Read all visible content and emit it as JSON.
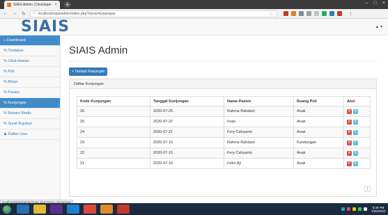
{
  "browser": {
    "tab_title": "SIAIS Admin | Developer",
    "url": "localhost/siais/admin/index.php?menu=kunjungan",
    "status_url": "localhost/siais/admin/index.php?menu=kunjungan"
  },
  "app": {
    "brand": "SIAIS",
    "page_title": "SIAIS Admin",
    "user_menu": "▲ ▾"
  },
  "sidebar": {
    "items": [
      {
        "label": "Dashboard",
        "icon": "home-icon",
        "active": false
      },
      {
        "label": "% Tindakan",
        "icon": "",
        "active": false
      },
      {
        "label": "% Obat-obatan",
        "icon": "",
        "active": false
      },
      {
        "label": "% Poli",
        "icon": "",
        "active": false
      },
      {
        "label": "% Bidan",
        "icon": "",
        "active": false
      },
      {
        "label": "% Pasien",
        "icon": "",
        "active": false
      },
      {
        "label": "% Kunjungan",
        "icon": "",
        "active": true
      },
      {
        "label": "% Rekam Medis",
        "icon": "",
        "active": false
      },
      {
        "label": "% Surat Rujukan",
        "icon": "",
        "active": false
      },
      {
        "label": "Daftar User",
        "icon": "user-icon",
        "active": false
      }
    ]
  },
  "main": {
    "add_button": "+ Tambah Kunjungan",
    "panel_heading": "Daftar Kunjungan",
    "pager": "1",
    "table": {
      "headers": [
        "Kode Kunjungan",
        "Tanggal Kunjungan",
        "Nama Pasien",
        "Ruang Poli",
        "Aksi"
      ],
      "rows": [
        [
          "26",
          "2020-07-26",
          "Rahma Rahdani",
          "Anak"
        ],
        [
          "25",
          "2020-07-22",
          "Irvan",
          "Anak"
        ],
        [
          "24",
          "2020-07-21",
          "Fery Cahyanto",
          "Anak"
        ],
        [
          "23",
          "2020-07-16",
          "Rahma Rahdani",
          "Kandungan"
        ],
        [
          "22",
          "2020-07-16",
          "Fery Cahyanto",
          "Anak"
        ],
        [
          "21",
          "2020-07-16",
          "Febri Aji",
          "Anak"
        ]
      ]
    }
  },
  "colors": {
    "primary": "#337ab7",
    "active_nav": "#428bca",
    "delete": "#d9534f",
    "edit": "#5bc0de"
  },
  "taskbar": {
    "time": "8:39 PM",
    "date": "7/26/2020"
  }
}
